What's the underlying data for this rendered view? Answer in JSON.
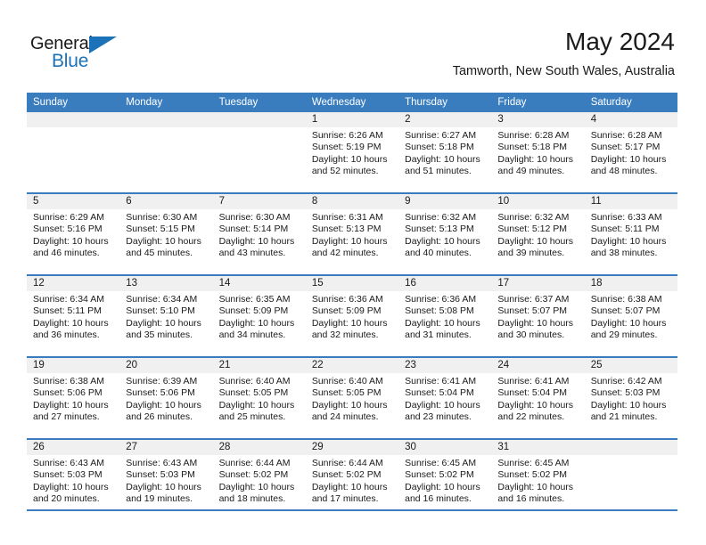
{
  "logo": {
    "word1": "General",
    "word2": "Blue",
    "triangle_color": "#1b72b8"
  },
  "header": {
    "title": "May 2024",
    "subtitle": "Tamworth, New South Wales, Australia"
  },
  "theme": {
    "header_blue": "#3a7dbf",
    "daynum_band": "#f0f0f0",
    "text": "#1a1a1a"
  },
  "weekday_headers": [
    "Sunday",
    "Monday",
    "Tuesday",
    "Wednesday",
    "Thursday",
    "Friday",
    "Saturday"
  ],
  "weeks": [
    [
      {
        "day": "",
        "empty": true,
        "sunrise": "",
        "sunset": "",
        "daylight_1": "",
        "daylight_2": ""
      },
      {
        "day": "",
        "empty": true,
        "sunrise": "",
        "sunset": "",
        "daylight_1": "",
        "daylight_2": ""
      },
      {
        "day": "",
        "empty": true,
        "sunrise": "",
        "sunset": "",
        "daylight_1": "",
        "daylight_2": ""
      },
      {
        "day": "1",
        "empty": false,
        "sunrise": "Sunrise: 6:26 AM",
        "sunset": "Sunset: 5:19 PM",
        "daylight_1": "Daylight: 10 hours",
        "daylight_2": "and 52 minutes."
      },
      {
        "day": "2",
        "empty": false,
        "sunrise": "Sunrise: 6:27 AM",
        "sunset": "Sunset: 5:18 PM",
        "daylight_1": "Daylight: 10 hours",
        "daylight_2": "and 51 minutes."
      },
      {
        "day": "3",
        "empty": false,
        "sunrise": "Sunrise: 6:28 AM",
        "sunset": "Sunset: 5:18 PM",
        "daylight_1": "Daylight: 10 hours",
        "daylight_2": "and 49 minutes."
      },
      {
        "day": "4",
        "empty": false,
        "sunrise": "Sunrise: 6:28 AM",
        "sunset": "Sunset: 5:17 PM",
        "daylight_1": "Daylight: 10 hours",
        "daylight_2": "and 48 minutes."
      }
    ],
    [
      {
        "day": "5",
        "empty": false,
        "sunrise": "Sunrise: 6:29 AM",
        "sunset": "Sunset: 5:16 PM",
        "daylight_1": "Daylight: 10 hours",
        "daylight_2": "and 46 minutes."
      },
      {
        "day": "6",
        "empty": false,
        "sunrise": "Sunrise: 6:30 AM",
        "sunset": "Sunset: 5:15 PM",
        "daylight_1": "Daylight: 10 hours",
        "daylight_2": "and 45 minutes."
      },
      {
        "day": "7",
        "empty": false,
        "sunrise": "Sunrise: 6:30 AM",
        "sunset": "Sunset: 5:14 PM",
        "daylight_1": "Daylight: 10 hours",
        "daylight_2": "and 43 minutes."
      },
      {
        "day": "8",
        "empty": false,
        "sunrise": "Sunrise: 6:31 AM",
        "sunset": "Sunset: 5:13 PM",
        "daylight_1": "Daylight: 10 hours",
        "daylight_2": "and 42 minutes."
      },
      {
        "day": "9",
        "empty": false,
        "sunrise": "Sunrise: 6:32 AM",
        "sunset": "Sunset: 5:13 PM",
        "daylight_1": "Daylight: 10 hours",
        "daylight_2": "and 40 minutes."
      },
      {
        "day": "10",
        "empty": false,
        "sunrise": "Sunrise: 6:32 AM",
        "sunset": "Sunset: 5:12 PM",
        "daylight_1": "Daylight: 10 hours",
        "daylight_2": "and 39 minutes."
      },
      {
        "day": "11",
        "empty": false,
        "sunrise": "Sunrise: 6:33 AM",
        "sunset": "Sunset: 5:11 PM",
        "daylight_1": "Daylight: 10 hours",
        "daylight_2": "and 38 minutes."
      }
    ],
    [
      {
        "day": "12",
        "empty": false,
        "sunrise": "Sunrise: 6:34 AM",
        "sunset": "Sunset: 5:11 PM",
        "daylight_1": "Daylight: 10 hours",
        "daylight_2": "and 36 minutes."
      },
      {
        "day": "13",
        "empty": false,
        "sunrise": "Sunrise: 6:34 AM",
        "sunset": "Sunset: 5:10 PM",
        "daylight_1": "Daylight: 10 hours",
        "daylight_2": "and 35 minutes."
      },
      {
        "day": "14",
        "empty": false,
        "sunrise": "Sunrise: 6:35 AM",
        "sunset": "Sunset: 5:09 PM",
        "daylight_1": "Daylight: 10 hours",
        "daylight_2": "and 34 minutes."
      },
      {
        "day": "15",
        "empty": false,
        "sunrise": "Sunrise: 6:36 AM",
        "sunset": "Sunset: 5:09 PM",
        "daylight_1": "Daylight: 10 hours",
        "daylight_2": "and 32 minutes."
      },
      {
        "day": "16",
        "empty": false,
        "sunrise": "Sunrise: 6:36 AM",
        "sunset": "Sunset: 5:08 PM",
        "daylight_1": "Daylight: 10 hours",
        "daylight_2": "and 31 minutes."
      },
      {
        "day": "17",
        "empty": false,
        "sunrise": "Sunrise: 6:37 AM",
        "sunset": "Sunset: 5:07 PM",
        "daylight_1": "Daylight: 10 hours",
        "daylight_2": "and 30 minutes."
      },
      {
        "day": "18",
        "empty": false,
        "sunrise": "Sunrise: 6:38 AM",
        "sunset": "Sunset: 5:07 PM",
        "daylight_1": "Daylight: 10 hours",
        "daylight_2": "and 29 minutes."
      }
    ],
    [
      {
        "day": "19",
        "empty": false,
        "sunrise": "Sunrise: 6:38 AM",
        "sunset": "Sunset: 5:06 PM",
        "daylight_1": "Daylight: 10 hours",
        "daylight_2": "and 27 minutes."
      },
      {
        "day": "20",
        "empty": false,
        "sunrise": "Sunrise: 6:39 AM",
        "sunset": "Sunset: 5:06 PM",
        "daylight_1": "Daylight: 10 hours",
        "daylight_2": "and 26 minutes."
      },
      {
        "day": "21",
        "empty": false,
        "sunrise": "Sunrise: 6:40 AM",
        "sunset": "Sunset: 5:05 PM",
        "daylight_1": "Daylight: 10 hours",
        "daylight_2": "and 25 minutes."
      },
      {
        "day": "22",
        "empty": false,
        "sunrise": "Sunrise: 6:40 AM",
        "sunset": "Sunset: 5:05 PM",
        "daylight_1": "Daylight: 10 hours",
        "daylight_2": "and 24 minutes."
      },
      {
        "day": "23",
        "empty": false,
        "sunrise": "Sunrise: 6:41 AM",
        "sunset": "Sunset: 5:04 PM",
        "daylight_1": "Daylight: 10 hours",
        "daylight_2": "and 23 minutes."
      },
      {
        "day": "24",
        "empty": false,
        "sunrise": "Sunrise: 6:41 AM",
        "sunset": "Sunset: 5:04 PM",
        "daylight_1": "Daylight: 10 hours",
        "daylight_2": "and 22 minutes."
      },
      {
        "day": "25",
        "empty": false,
        "sunrise": "Sunrise: 6:42 AM",
        "sunset": "Sunset: 5:03 PM",
        "daylight_1": "Daylight: 10 hours",
        "daylight_2": "and 21 minutes."
      }
    ],
    [
      {
        "day": "26",
        "empty": false,
        "sunrise": "Sunrise: 6:43 AM",
        "sunset": "Sunset: 5:03 PM",
        "daylight_1": "Daylight: 10 hours",
        "daylight_2": "and 20 minutes."
      },
      {
        "day": "27",
        "empty": false,
        "sunrise": "Sunrise: 6:43 AM",
        "sunset": "Sunset: 5:03 PM",
        "daylight_1": "Daylight: 10 hours",
        "daylight_2": "and 19 minutes."
      },
      {
        "day": "28",
        "empty": false,
        "sunrise": "Sunrise: 6:44 AM",
        "sunset": "Sunset: 5:02 PM",
        "daylight_1": "Daylight: 10 hours",
        "daylight_2": "and 18 minutes."
      },
      {
        "day": "29",
        "empty": false,
        "sunrise": "Sunrise: 6:44 AM",
        "sunset": "Sunset: 5:02 PM",
        "daylight_1": "Daylight: 10 hours",
        "daylight_2": "and 17 minutes."
      },
      {
        "day": "30",
        "empty": false,
        "sunrise": "Sunrise: 6:45 AM",
        "sunset": "Sunset: 5:02 PM",
        "daylight_1": "Daylight: 10 hours",
        "daylight_2": "and 16 minutes."
      },
      {
        "day": "31",
        "empty": false,
        "sunrise": "Sunrise: 6:45 AM",
        "sunset": "Sunset: 5:02 PM",
        "daylight_1": "Daylight: 10 hours",
        "daylight_2": "and 16 minutes."
      },
      {
        "day": "",
        "empty": true,
        "sunrise": "",
        "sunset": "",
        "daylight_1": "",
        "daylight_2": ""
      }
    ]
  ]
}
